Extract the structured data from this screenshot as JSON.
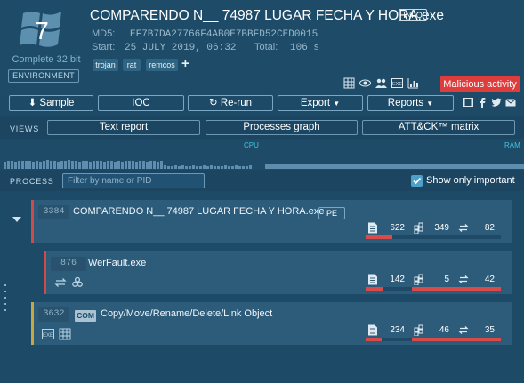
{
  "header": {
    "os_caption": "Complete 32 bit",
    "environment_label": "ENVIRONMENT",
    "title": "COMPARENDO N__ 74987 LUGAR FECHA Y HORA.exe",
    "info_label": "INFO",
    "md5_label": "MD5:",
    "md5_value": "EF7B7DA27766F4AB0E7BBFD52CED0015",
    "start_label": "Start:",
    "start_value": "25 JULY 2019, 06:32",
    "total_label": "Total:",
    "total_value": "106 s",
    "tags": [
      "trojan",
      "rat",
      "remcos"
    ],
    "verdict": "Malicious activity",
    "colors": {
      "accent": "#1e4c68",
      "malicious": "#df3c3c"
    }
  },
  "toolbar": {
    "sample": "Sample",
    "ioc": "IOC",
    "rerun": "Re-run",
    "export": "Export",
    "reports": "Reports"
  },
  "views": {
    "label": "VIEWS",
    "text_report": "Text report",
    "processes_graph": "Processes graph",
    "attck": "ATT&CK™ matrix"
  },
  "graphs": {
    "cpu_label": "CPU",
    "ram_label": "RAM"
  },
  "process_panel": {
    "label": "PROCESS",
    "filter_placeholder": "Filter by name or PID",
    "only_important_label": "Show only important",
    "only_important": true
  },
  "processes": [
    {
      "pid": "3384",
      "name": "COMPARENDO N__ 74987 LUGAR FECHA Y HORA.exe",
      "badge": "PE",
      "files": "622",
      "registry": "349",
      "network": "82",
      "file_bar_fraction": 0.3,
      "registry_bar_fraction": 0.45
    },
    {
      "pid": "876",
      "name": "WerFault.exe",
      "files": "142",
      "registry": "5",
      "network": "42",
      "file_bar_fraction": 0.35,
      "registry_bar_fraction": 0.25
    },
    {
      "pid": "3632",
      "name": "Copy/Move/Rename/Delete/Link Object",
      "badge": "COM",
      "files": "234",
      "registry": "46",
      "network": "35",
      "file_bar_fraction": 0.35,
      "registry_bar_fraction": 0.75
    }
  ]
}
